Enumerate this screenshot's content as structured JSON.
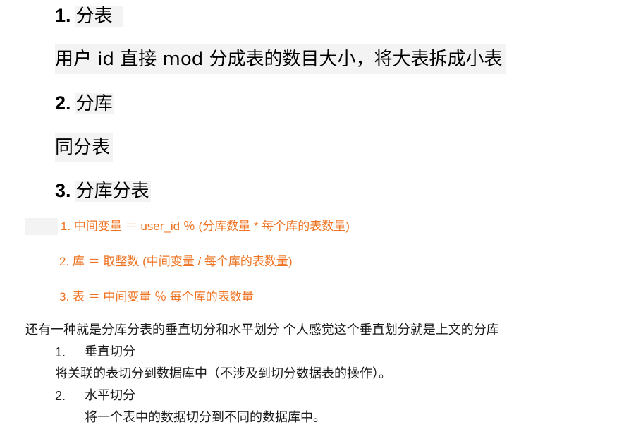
{
  "headings": {
    "h1": {
      "num": "1.",
      "text": "分表"
    },
    "h2": {
      "num": "2.",
      "text": "分库"
    },
    "h3": {
      "num": "3.",
      "text": "分库分表"
    }
  },
  "paragraphs": {
    "p1": "用户 id 直接 mod 分成表的数目大小，将大表拆成小表",
    "p2": "同分表"
  },
  "formulas": [
    "1. 中间变量 ＝ user_id ％ (分库数量 * 每个库的表数量)",
    "2. 库 ＝ 取整数 (中间变量 / 每个库的表数量)",
    "3. 表 ＝ 中间变量 ％ 每个库的表数量"
  ],
  "summary": "还有一种就是分库分表的垂直切分和水平划分  个人感觉这个垂直划分就是上文的分库",
  "list": [
    {
      "num": "1.",
      "title": "垂直切分",
      "desc": "将关联的表切分到数据库中（不涉及到切分数据表的操作）。"
    },
    {
      "num": "2.",
      "title": "水平切分",
      "desc": "将一个表中的数据切分到不同的数据库中。"
    }
  ],
  "colors": {
    "formula": "#ee7322",
    "highlight": "#f3f3f3"
  }
}
